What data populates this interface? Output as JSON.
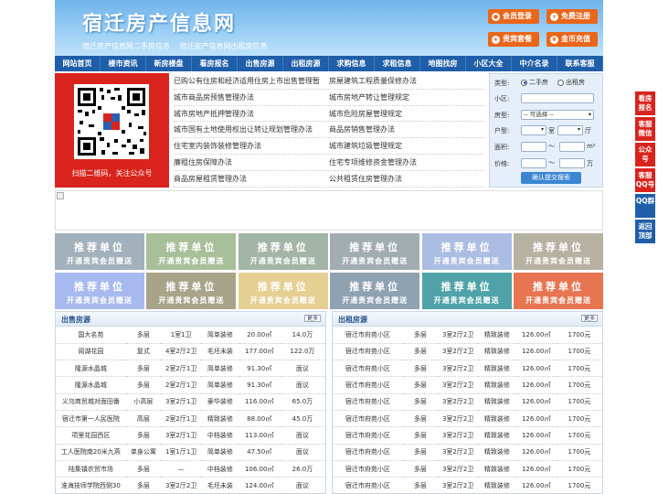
{
  "header": {
    "title": "宿迁房产信息网",
    "sub1": "宿迁房产信息网二手房信息",
    "sub2": "宿迁房产信息网出租房信息",
    "btn_login": "会员登录",
    "btn_register": "免费注册",
    "btn_vip": "贵宾套餐",
    "btn_recharge": "金币充值"
  },
  "nav": [
    "网站首页",
    "楼市资讯",
    "新房楼盘",
    "看房报名",
    "出售房源",
    "出租房源",
    "求购信息",
    "求租信息",
    "地图找房",
    "小区大全",
    "中介名录",
    "联系客服"
  ],
  "qr": {
    "caption": "扫描二维码，关注公众号"
  },
  "links": [
    [
      "已购公有住房和经济适用住房上市出售管理暂",
      "房屋建筑工程质量保修办法"
    ],
    [
      "城市商品房预售管理办法",
      "城市房地产转让管理规定"
    ],
    [
      "城市房地产抵押管理办法",
      "城市危险房屋管理规定"
    ],
    [
      "城市国有土地使用权出让转让规划管理办法",
      "商品房销售管理办法"
    ],
    [
      "住宅室内装饰装修管理办法",
      "城市建筑垃圾管理规定"
    ],
    [
      "廉租住房保障办法",
      "住宅专项维修资金管理办法"
    ],
    [
      "商品房屋租赁管理办法",
      "公共租赁住房管理办法"
    ]
  ],
  "search": {
    "type_label": "类型:",
    "opt_sale": "二手房",
    "opt_rent": "出租房",
    "community_label": "小区:",
    "housetype_label": "房型:",
    "housetype_value": "-- 可选择 --",
    "layout_label": "户型:",
    "room": "室",
    "hall": "厅",
    "area_label": "面积:",
    "area_unit": "m²",
    "price_label": "价格:",
    "price_unit": "万",
    "tilde": "〜",
    "submit": "确认提交搜索"
  },
  "rec": {
    "line1": "推荐单位",
    "line2": "开通贵宾会员赠送",
    "colors": [
      "#a3b1bd",
      "#a8bf9a",
      "#a3b5a6",
      "#a2adb2",
      "#acbde3",
      "#b7b1a2",
      "#a7baf0",
      "#a7a48a",
      "#e6cf92",
      "#8fa2b2",
      "#4fa3a8",
      "#e77552"
    ]
  },
  "sale": {
    "title": "出售房源",
    "more": "更多",
    "rows": [
      [
        "国大名苑",
        "多层",
        "1室1卫",
        "简单装修",
        "20.00㎡",
        "14.0万"
      ],
      [
        "阅湖花园",
        "复式",
        "4室2厅2卫",
        "毛坯未装",
        "177.00㎡",
        "122.0万"
      ],
      [
        "隆源水晶城",
        "多层",
        "2室2厅1卫",
        "简单装修",
        "91.30㎡",
        "面议"
      ],
      [
        "隆源水晶城",
        "多层",
        "2室2厅1卫",
        "简单装修",
        "91.30㎡",
        "面议"
      ],
      [
        "义乌商贸城对面田番",
        "小高层",
        "3室2厅1卫",
        "豪华装修",
        "116.00㎡",
        "65.0万"
      ],
      [
        "宿迁市第一人民医院",
        "高层",
        "2室2厅1卫",
        "精致装修",
        "88.00㎡",
        "45.0万"
      ],
      [
        "项里花园西区",
        "多层",
        "3室2厅1卫",
        "中档装修",
        "113.00㎡",
        "面议"
      ],
      [
        "工人医院南20米九燕",
        "单身公寓",
        "1室1厅1卫",
        "简单装修",
        "47.50㎡",
        "面议"
      ],
      [
        "陆集镇农贸市场",
        "多层",
        "—",
        "中档装修",
        "106.00㎡",
        "26.0万"
      ],
      [
        "淮海技师学院西侧30",
        "多层",
        "3室2厅2卫",
        "毛坯未装",
        "124.00㎡",
        "面议"
      ]
    ]
  },
  "rent": {
    "title": "出租房源",
    "more": "更多",
    "rows": [
      [
        "宿迁市府苑小区",
        "多层",
        "3室2厅2卫",
        "精致装修",
        "126.00㎡",
        "1700元"
      ],
      [
        "宿迁市府苑小区",
        "多层",
        "3室2厅2卫",
        "精致装修",
        "126.00㎡",
        "1700元"
      ],
      [
        "宿迁市府苑小区",
        "多层",
        "3室2厅2卫",
        "精致装修",
        "126.00㎡",
        "1700元"
      ],
      [
        "宿迁市府苑小区",
        "多层",
        "3室2厅2卫",
        "精致装修",
        "126.00㎡",
        "1700元"
      ],
      [
        "宿迁市府苑小区",
        "多层",
        "3室2厅2卫",
        "精致装修",
        "126.00㎡",
        "1700元"
      ],
      [
        "宿迁市府苑小区",
        "多层",
        "3室2厅2卫",
        "精致装修",
        "126.00㎡",
        "1700元"
      ],
      [
        "宿迁市府苑小区",
        "多层",
        "3室2厅2卫",
        "精致装修",
        "126.00㎡",
        "1700元"
      ],
      [
        "宿迁市府苑小区",
        "多层",
        "3室2厅2卫",
        "精致装修",
        "126.00㎡",
        "1700元"
      ],
      [
        "宿迁市府苑小区",
        "多层",
        "3室2厅2卫",
        "精致装修",
        "126.00㎡",
        "1700元"
      ],
      [
        "宿迁市府苑小区",
        "多层",
        "3室2厅2卫",
        "精致装修",
        "126.00㎡",
        "1700元"
      ]
    ]
  },
  "float": [
    {
      "label": "看房报名",
      "color": "red"
    },
    {
      "label": "客服微信",
      "color": "red"
    },
    {
      "label": "公众号",
      "color": "red"
    },
    {
      "label": "客服QQ号",
      "color": "red"
    },
    {
      "label": "QQ群",
      "color": "blue"
    },
    {
      "label": "返回顶部",
      "color": "blue"
    }
  ]
}
